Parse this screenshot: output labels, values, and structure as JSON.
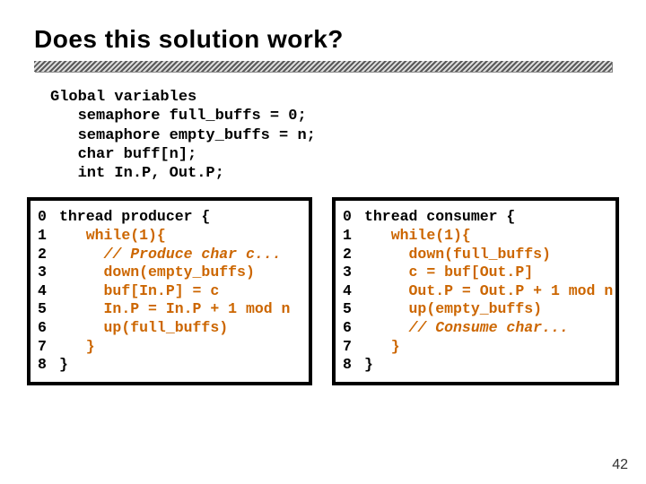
{
  "title": "Does this solution work?",
  "globals": {
    "heading": "Global variables",
    "line1": "semaphore full_buffs = 0;",
    "line2": "semaphore empty_buffs = n;",
    "line3": "char buff[n];",
    "line4": "int In.P, Out.P;"
  },
  "producer": {
    "lines": [
      {
        "n": "0",
        "pre": "",
        "txt": "thread producer {",
        "style": "plain"
      },
      {
        "n": "1",
        "pre": "   ",
        "txt": "while(1){",
        "style": "kw"
      },
      {
        "n": "2",
        "pre": "     ",
        "txt": "// Produce char c...",
        "style": "cm"
      },
      {
        "n": "3",
        "pre": "     ",
        "txt": "down(empty_buffs)",
        "style": "kw"
      },
      {
        "n": "4",
        "pre": "     ",
        "txt": "buf[In.P] = c",
        "style": "kw"
      },
      {
        "n": "5",
        "pre": "     ",
        "txt": "In.P = In.P + 1 mod n",
        "style": "kw"
      },
      {
        "n": "6",
        "pre": "     ",
        "txt": "up(full_buffs)",
        "style": "kw"
      },
      {
        "n": "7",
        "pre": "   ",
        "txt": "}",
        "style": "kw"
      },
      {
        "n": "8",
        "pre": "",
        "txt": "}",
        "style": "plain"
      }
    ]
  },
  "consumer": {
    "lines": [
      {
        "n": "0",
        "pre": "",
        "txt": "thread consumer {",
        "style": "plain"
      },
      {
        "n": "1",
        "pre": "   ",
        "txt": "while(1){",
        "style": "kw"
      },
      {
        "n": "2",
        "pre": "     ",
        "txt": "down(full_buffs)",
        "style": "kw"
      },
      {
        "n": "3",
        "pre": "     ",
        "txt": "c = buf[Out.P]",
        "style": "kw"
      },
      {
        "n": "4",
        "pre": "     ",
        "txt": "Out.P = Out.P + 1 mod n",
        "style": "kw"
      },
      {
        "n": "5",
        "pre": "     ",
        "txt": "up(empty_buffs)",
        "style": "kw"
      },
      {
        "n": "6",
        "pre": "     ",
        "txt": "// Consume char...",
        "style": "cm"
      },
      {
        "n": "7",
        "pre": "   ",
        "txt": "}",
        "style": "kw"
      },
      {
        "n": "8",
        "pre": "",
        "txt": "}",
        "style": "plain"
      }
    ]
  },
  "page_number": "42"
}
